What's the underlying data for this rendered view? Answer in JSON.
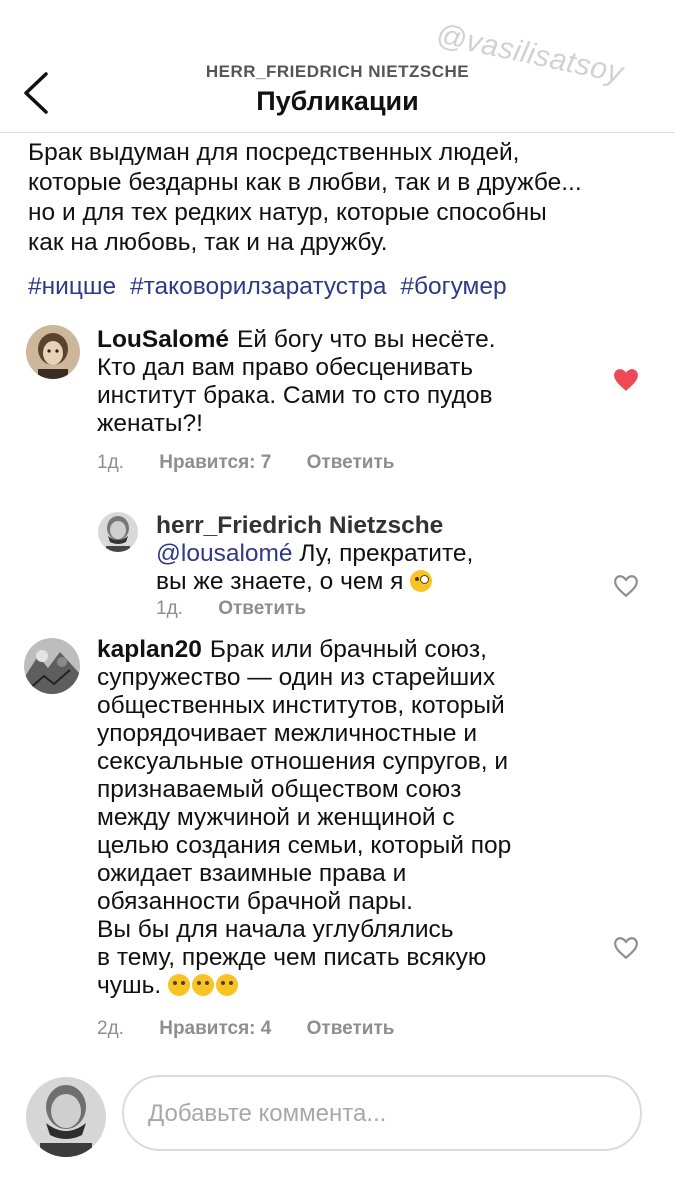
{
  "header": {
    "back_icon": "chevron-left-icon",
    "account": "HERR_FRIEDRICH NIETZSCHE",
    "title": "Публикации",
    "watermark": "@vasilisatsoy"
  },
  "post": {
    "caption_lines": [
      "Брак выдуман для посредственных людей,",
      "которые бездарны как в любви, так и в дружбе...",
      "но и для тех редких натур, которые способны",
      "как на любовь, так и на дружбу."
    ],
    "hashtags": [
      "#ницше",
      "#таковорилзаратустра",
      "#богумер"
    ]
  },
  "comments": [
    {
      "username": "LouSalomé",
      "lines": [
        "Ей богу что вы несёте.",
        "Кто дал вам право обесценивать",
        "институт брака. Сами то сто пудов",
        "женаты?!"
      ],
      "time": "1д.",
      "likes": "Нравится: 7",
      "reply": "Ответить",
      "liked": true,
      "heart_color": "#ed4956"
    },
    {
      "username": "herr_Friedrich Nietzsche",
      "mention": "@lousalomé",
      "line1_rest": " Лу, прекратите,",
      "line2": "вы же знаете, о чем я",
      "emoji": "winking-face-with-tongue",
      "time": "1д.",
      "reply": "Ответить",
      "liked": false
    },
    {
      "username": "kaplan20",
      "lines": [
        "Брак или брачный союз,",
        "супружество — один из старейших",
        "общественных институтов, который",
        "упорядочивает межличностные и",
        "сексуальные отношения супругов, и",
        "признаваемый обществом союз",
        "между мужчиной и женщиной с",
        "целью создания семьи, который пор",
        "ожидает взаимные права и",
        "обязанности брачной пары.",
        "Вы бы для начала углублялись",
        "в тему, прежде чем писать всякую",
        "чушь."
      ],
      "emojis": [
        "rolling-on-floor-laughing",
        "rolling-on-floor-laughing",
        "rolling-on-floor-laughing"
      ],
      "time": "2д.",
      "likes": "Нравится: 4",
      "reply": "Ответить",
      "liked": false
    }
  ],
  "composer": {
    "placeholder": "Добавьте коммента..."
  }
}
